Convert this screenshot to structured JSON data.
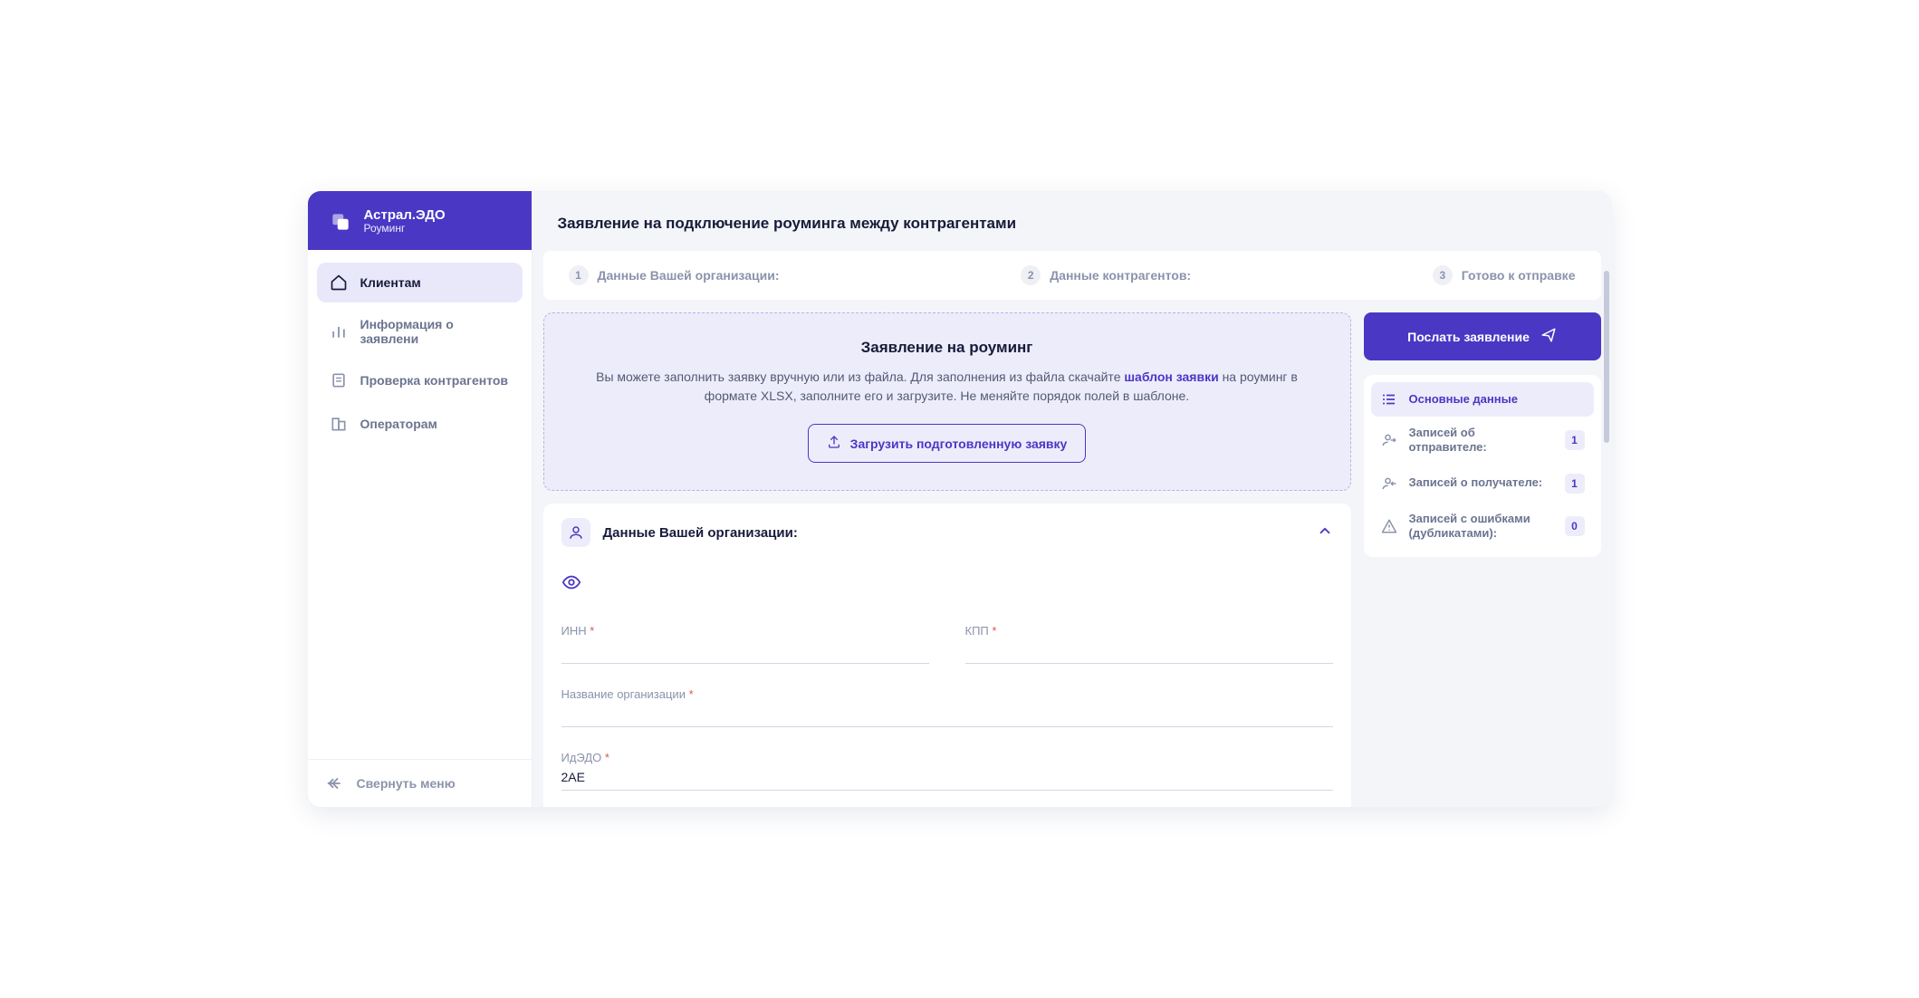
{
  "brand": {
    "title": "Астрал.ЭДО",
    "subtitle": "Роуминг"
  },
  "sidebar": {
    "items": [
      {
        "label": "Клиентам"
      },
      {
        "label": "Информация о заявлени"
      },
      {
        "label": "Проверка контрагентов"
      },
      {
        "label": "Операторам"
      }
    ],
    "collapse": "Свернуть меню"
  },
  "page": {
    "title": "Заявление на подключение роуминга между контрагентами"
  },
  "steps": [
    {
      "num": "1",
      "label": "Данные Вашей организации:"
    },
    {
      "num": "2",
      "label": "Данные контрагентов:"
    },
    {
      "num": "3",
      "label": "Готово к отправке"
    }
  ],
  "info": {
    "title": "Заявление на роуминг",
    "desc_before": "Вы можете заполнить заявку вручную или из файла. Для заполнения из файла скачайте ",
    "link": "шаблон заявки",
    "desc_after": " на роуминг в формате XLSX, заполните его и загрузите. Не меняйте порядок полей в шаблоне.",
    "upload": "Загрузить подготовленную заявку"
  },
  "org_panel": {
    "title": "Данные Вашей организации:",
    "fields": {
      "inn_label": "ИНН",
      "kpp_label": "КПП",
      "name_label": "Название организации",
      "idedo_label": "ИдЭДО",
      "idedo_value": "2AE"
    }
  },
  "actions": {
    "send": "Послать заявление"
  },
  "stats": {
    "primary": "Основные данные",
    "sender": {
      "label": "Записей об отправителе:",
      "count": "1"
    },
    "receiver": {
      "label": "Записей о получателе:",
      "count": "1"
    },
    "errors": {
      "label": "Записей с ошибками (дубликатами):",
      "count": "0"
    }
  }
}
